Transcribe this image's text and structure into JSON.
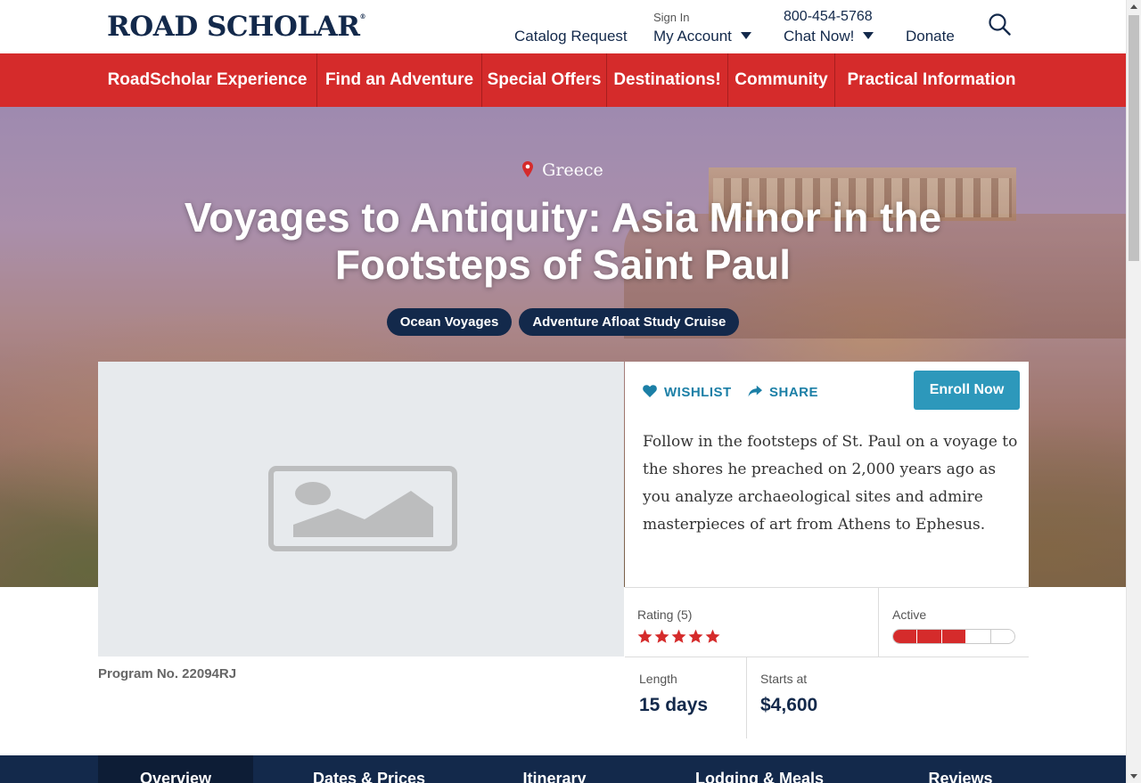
{
  "header": {
    "logo": "ROAD SCHOLAR",
    "catalog_request": "Catalog Request",
    "sign_in": "Sign In",
    "my_account": "My Account",
    "phone": "800-454-5768",
    "chat_now": "Chat Now!",
    "donate": "Donate",
    "search_icon": "search-icon"
  },
  "nav": [
    {
      "label": "RoadScholar Experience"
    },
    {
      "label": "Find an Adventure"
    },
    {
      "label": "Special Offers"
    },
    {
      "label": "Destinations!"
    },
    {
      "label": "Community"
    },
    {
      "label": "Practical Information"
    }
  ],
  "hero": {
    "location": "Greece",
    "title": "Voyages to Antiquity: Asia Minor in the Footsteps of Saint Paul",
    "tags": [
      "Ocean Voyages",
      "Adventure Afloat Study Cruise"
    ]
  },
  "actions": {
    "wishlist": "WISHLIST",
    "share": "SHARE",
    "enroll": "Enroll Now"
  },
  "description": "Follow in the footsteps of St. Paul on a voyage to the shores he preached on 2,000 years ago as you analyze archaeological sites and admire masterpieces of art from Athens to Ephesus.",
  "stats": {
    "rating_label": "Rating (5)",
    "rating_value": 5,
    "activity_label": "Active",
    "activity_level": 3,
    "activity_max": 5,
    "length_label": "Length",
    "length_value": "15 days",
    "price_label": "Starts at",
    "price_value": "$4,600"
  },
  "program_number": "Program No. 22094RJ",
  "tabs": [
    {
      "label": "Overview",
      "active": true
    },
    {
      "label": "Dates & Prices",
      "active": false
    },
    {
      "label": "Itinerary",
      "active": false
    },
    {
      "label": "Lodging & Meals",
      "active": false
    },
    {
      "label": "Reviews",
      "active": false
    }
  ],
  "colors": {
    "brand_navy": "#13294b",
    "nav_red": "#d52b2b",
    "accent_blue": "#2d98bb",
    "star_red": "#d52b2b"
  }
}
